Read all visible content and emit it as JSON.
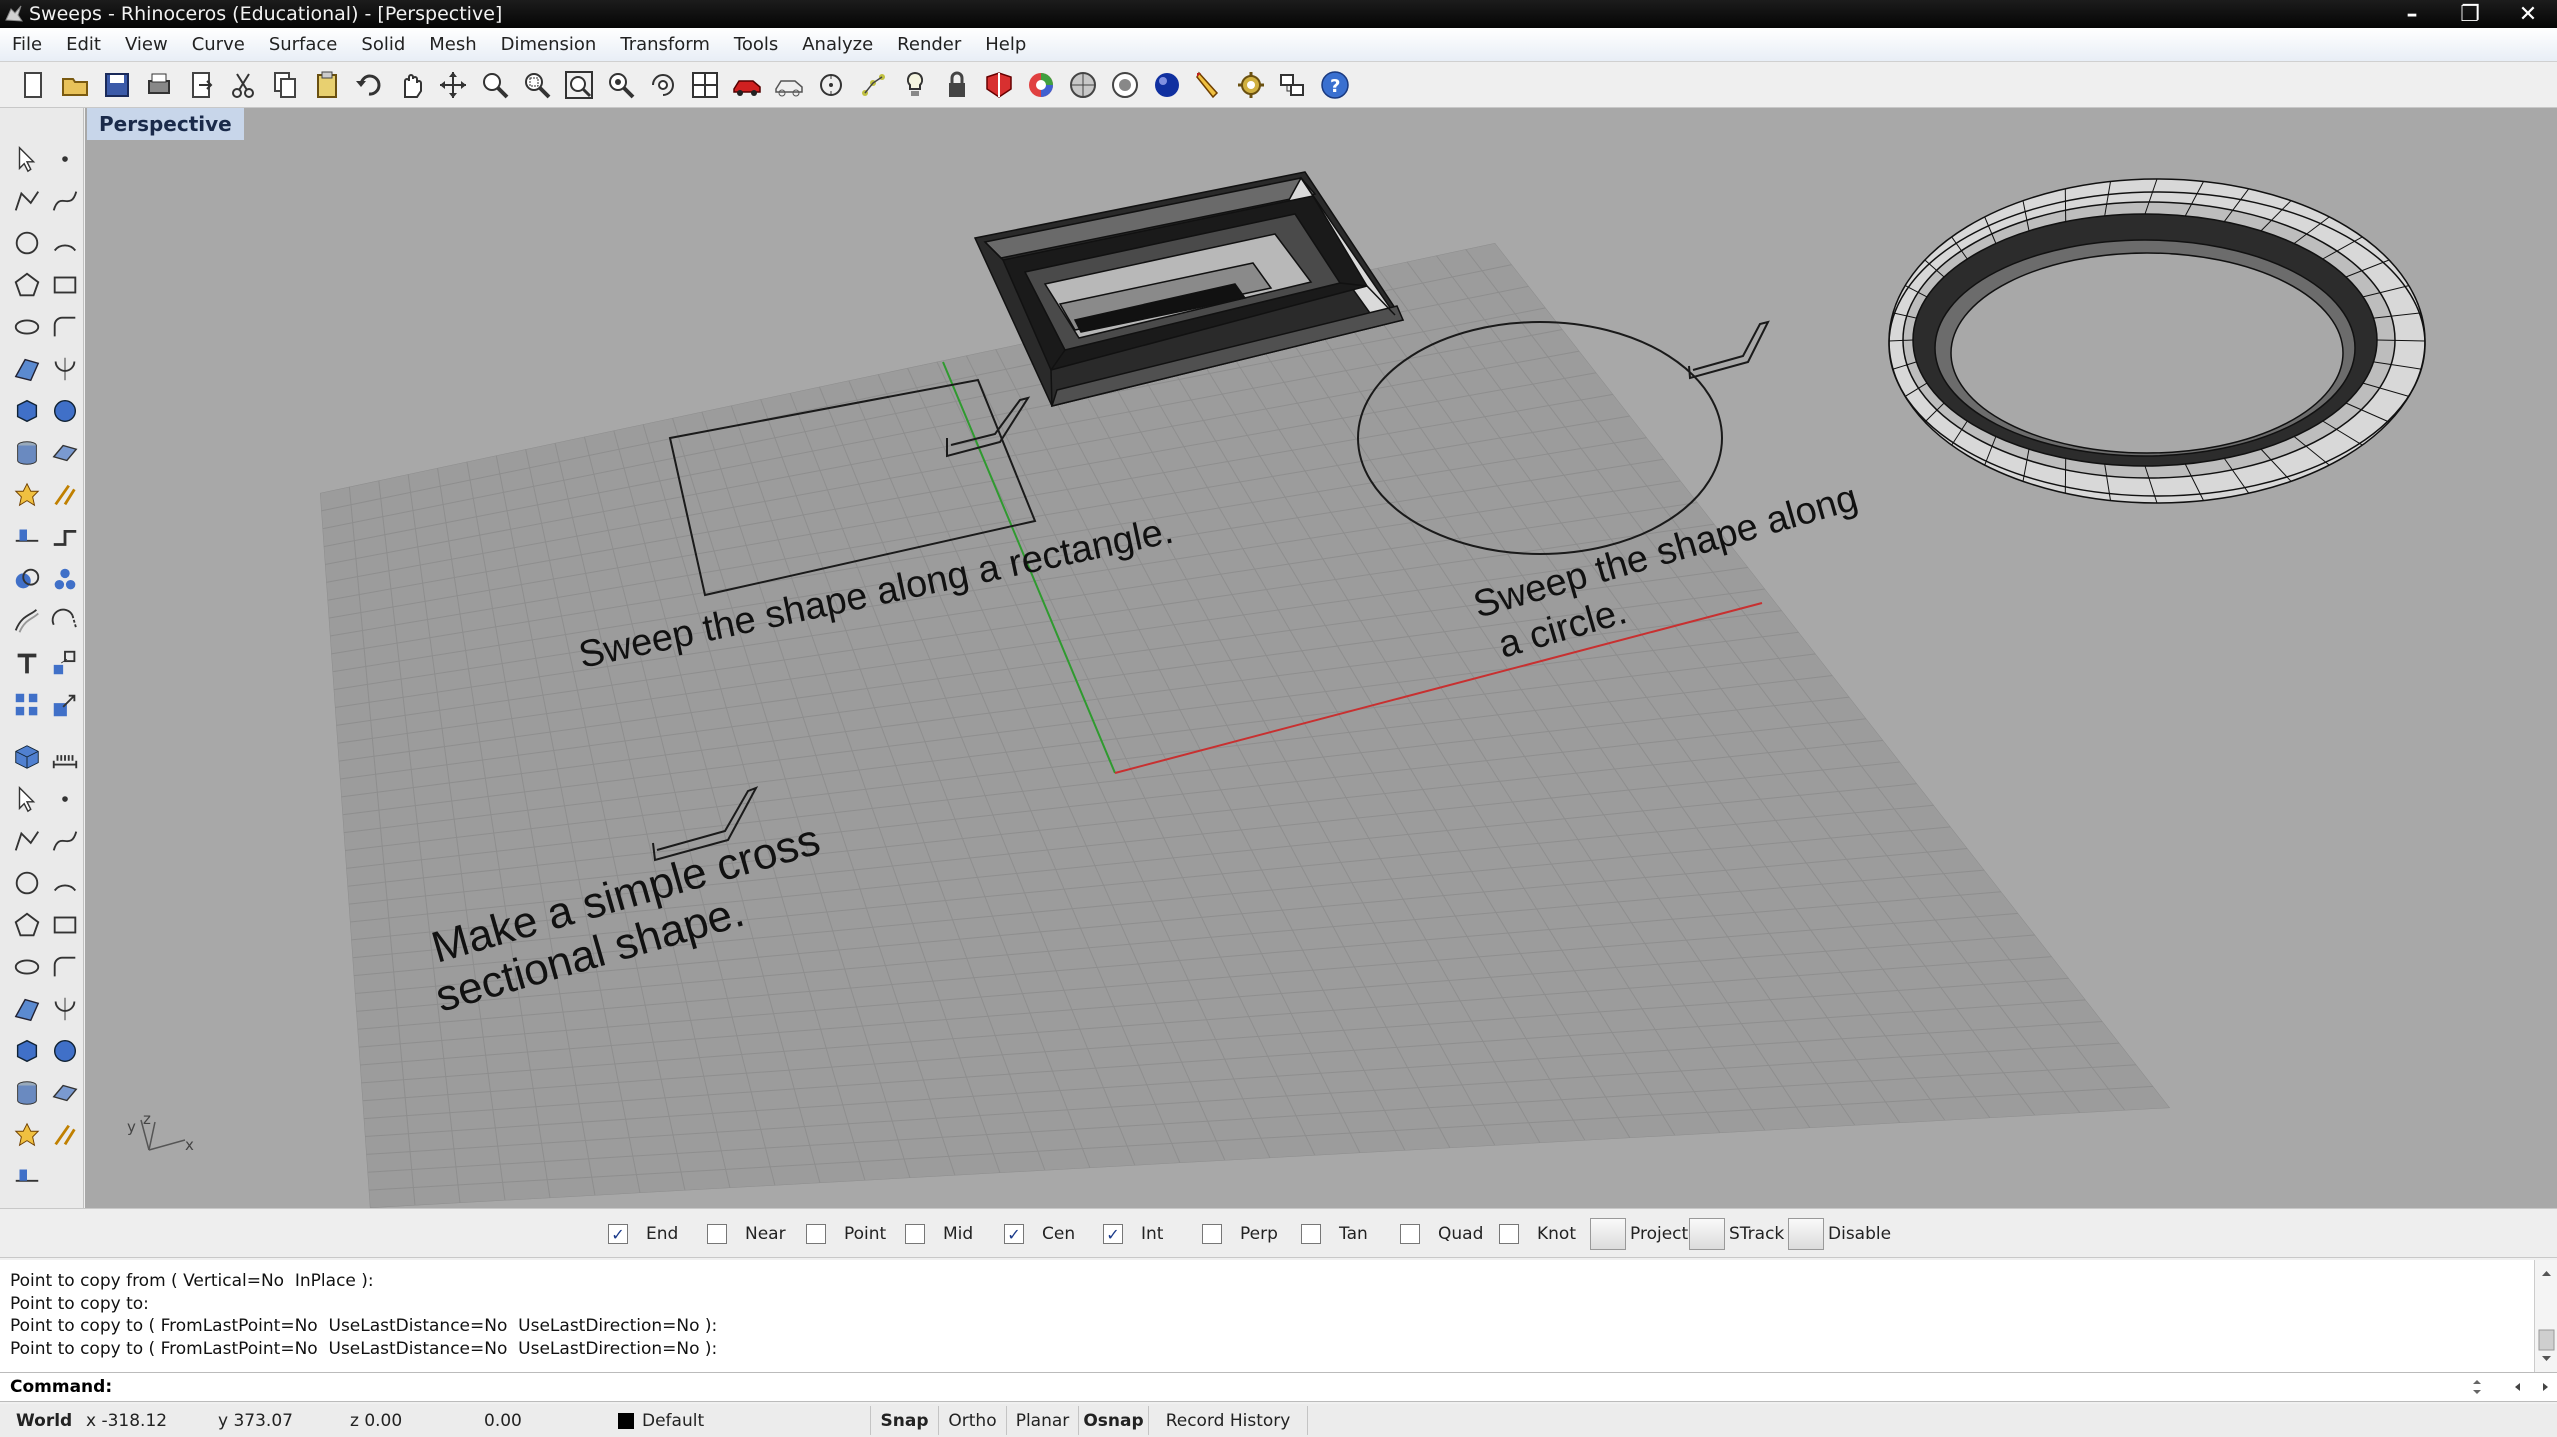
{
  "window": {
    "title": "Sweeps - Rhinoceros (Educational) - [Perspective]",
    "min": "–",
    "max": "❐",
    "close": "✕"
  },
  "menu": [
    "File",
    "Edit",
    "View",
    "Curve",
    "Surface",
    "Solid",
    "Mesh",
    "Dimension",
    "Transform",
    "Tools",
    "Analyze",
    "Render",
    "Help"
  ],
  "toolbar_icons": [
    "new-icon",
    "open-icon",
    "save-icon",
    "print-icon",
    "export-icon",
    "cut-icon",
    "copy-icon",
    "paste-icon",
    "undo-icon",
    "pan-icon",
    "rotate-view-icon",
    "zoom-icon",
    "zoom-window-icon",
    "zoom-extents-icon",
    "zoom-selected-icon",
    "rotate-icon",
    "viewports-icon",
    "car-icon",
    "wireframe-icon",
    "points-icon",
    "grid-snap-icon",
    "light-icon",
    "lock-icon",
    "shaded-icon",
    "rendered-icon",
    "ghosted-icon",
    "xray-icon",
    "render-icon",
    "pencil-icon",
    "settings-icon",
    "options-icon",
    "help-icon"
  ],
  "viewport": {
    "label": "Perspective",
    "text_rectangle": "Sweep the shape along a rectangle.",
    "text_circle_1": "Sweep the shape along",
    "text_circle_2": "a circle.",
    "text_shape_1": "Make a simple cross",
    "text_shape_2": "sectional shape.",
    "axis_y": "y",
    "axis_z": "z",
    "axis_x": "x"
  },
  "osnap": [
    {
      "label": "End",
      "checked": true
    },
    {
      "label": "Near",
      "checked": false
    },
    {
      "label": "Point",
      "checked": false
    },
    {
      "label": "Mid",
      "checked": false
    },
    {
      "label": "Cen",
      "checked": true
    },
    {
      "label": "Int",
      "checked": true
    },
    {
      "label": "Perp",
      "checked": false
    },
    {
      "label": "Tan",
      "checked": false
    },
    {
      "label": "Quad",
      "checked": false
    },
    {
      "label": "Knot",
      "checked": false
    }
  ],
  "osnap_toggles": [
    "Project",
    "STrack",
    "Disable"
  ],
  "command_history": [
    "Point to copy from ( Vertical=No  InPlace ):",
    "Point to copy to:",
    "Point to copy to ( FromLastPoint=No  UseLastDistance=No  UseLastDirection=No ):",
    "Point to copy to ( FromLastPoint=No  UseLastDistance=No  UseLastDirection=No ):"
  ],
  "command": {
    "label": "Command:",
    "value": ""
  },
  "status": {
    "cplane": "World",
    "x": "x -318.12",
    "y": "y 373.07",
    "z": "z 0.00",
    "dist": "0.00",
    "layer": "Default",
    "snap": "Snap",
    "ortho": "Ortho",
    "planar": "Planar",
    "osnap": "Osnap",
    "record": "Record History"
  },
  "colors": {
    "viewport_bg": "#a8a8a8",
    "grid": "#999999",
    "x_axis": "#c83030",
    "y_axis": "#2f9a2f",
    "tab_bg": "#c8d6ea"
  }
}
